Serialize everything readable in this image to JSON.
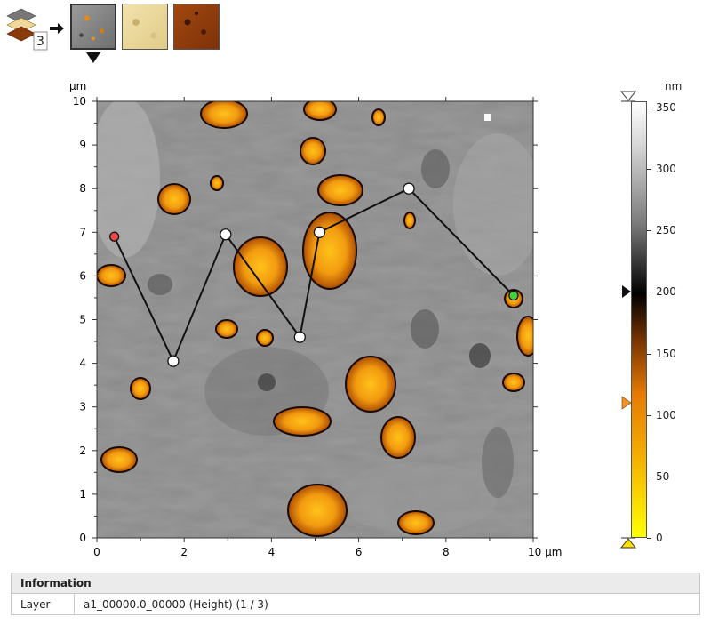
{
  "toolbar": {
    "layer_count": "3",
    "thumbnails": [
      "height-map-thumbnail",
      "amplitude-thumbnail",
      "phase-thumbnail"
    ],
    "selected_thumbnail": 0
  },
  "image": {
    "x_unit": "µm",
    "y_unit": "µm",
    "x_ticks": [
      "0",
      "2",
      "4",
      "6",
      "8",
      "10 µm"
    ],
    "y_ticks": [
      "0",
      "1",
      "2",
      "3",
      "4",
      "5",
      "6",
      "7",
      "8",
      "9",
      "10"
    ],
    "x_range": [
      0,
      10
    ],
    "y_range": [
      0,
      10
    ]
  },
  "profile_path": {
    "points_um": [
      [
        0.4,
        6.9
      ],
      [
        1.75,
        4.05
      ],
      [
        2.95,
        6.95
      ],
      [
        4.65,
        4.6
      ],
      [
        5.1,
        7.0
      ],
      [
        7.15,
        8.0
      ],
      [
        9.55,
        5.55
      ]
    ],
    "start_color": "#e84848",
    "end_color": "#3fd43f"
  },
  "colorbar": {
    "unit": "nm",
    "ticks": [
      "0",
      "50",
      "100",
      "150",
      "200",
      "250",
      "300",
      "350"
    ],
    "range": [
      0,
      355
    ],
    "upper_marker_nm": 200,
    "lower_marker_nm": 110
  },
  "info": {
    "title": "Information",
    "rows": [
      {
        "key": "Layer",
        "value": "a1_00000.0_00000 (Height) (1 / 3)"
      }
    ]
  }
}
